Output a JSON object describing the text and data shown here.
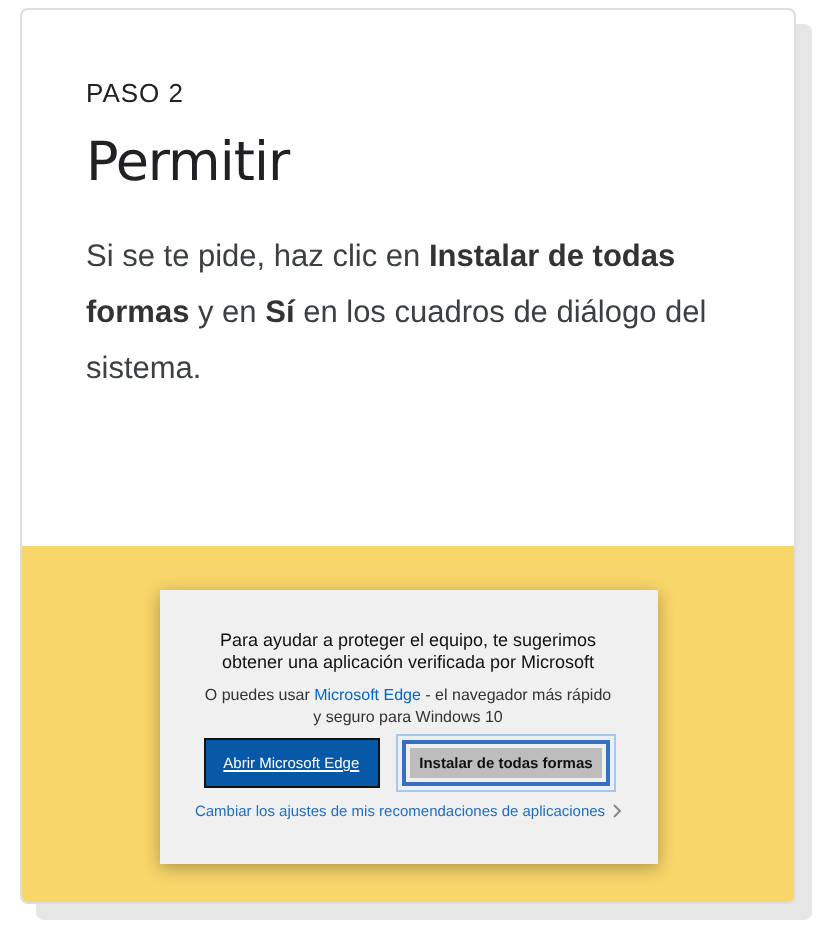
{
  "step": {
    "label": "PASO 2",
    "title": "Permitir",
    "body": "Si se te pide, haz clic en **Instalar de todas formas** y en **Sí** en los cuadros de diálogo del sistema."
  },
  "dialog": {
    "title": "Para ayudar a proteger el equipo, te sugerimos obtener una aplicación verificada por Microsoft",
    "text_before": "O puedes usar",
    "link": "Microsoft Edge",
    "text_after": "- el navegador más rápido y seguro para Windows 10",
    "buttons": [
      {
        "label": "Abrir Microsoft Edge",
        "kind": "primary",
        "focused": false
      },
      {
        "label": "Instalar de todas formas",
        "kind": "secondary",
        "focused": true
      }
    ],
    "settings_link": "Cambiar los ajustes de mis recomendaciones de aplicaciones"
  }
}
